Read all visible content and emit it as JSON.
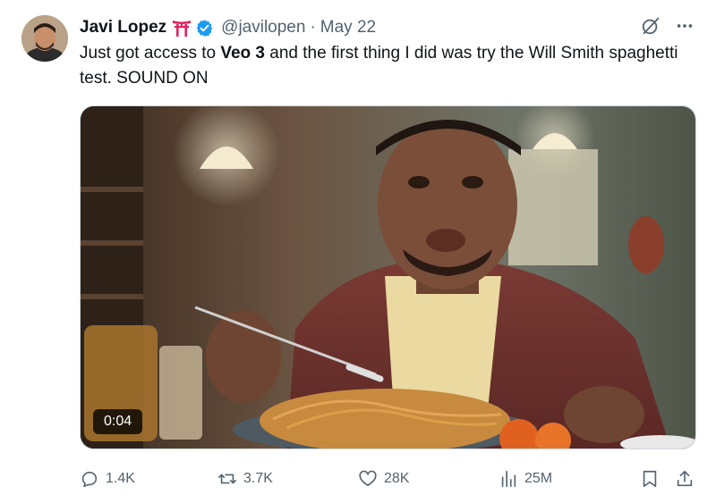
{
  "tweet": {
    "author_name": "Javi Lopez",
    "author_emoji": "torii-gate-emoji",
    "verified": true,
    "handle": "@javilopen",
    "separator": "·",
    "date": "May 22",
    "text_before": "Just got access to ",
    "text_bold": "Veo 3",
    "text_after": " and the first thing I did was try the Will Smith spaghetti test. SOUND ON"
  },
  "media": {
    "type": "video",
    "duration": "0:04"
  },
  "actions": {
    "replies": "1.4K",
    "reposts": "3.7K",
    "likes": "28K",
    "views": "25M"
  },
  "colors": {
    "text": "#0f1419",
    "secondary": "#536471",
    "verified_blue": "#1d9bf0",
    "torii_red": "#e0245e"
  }
}
